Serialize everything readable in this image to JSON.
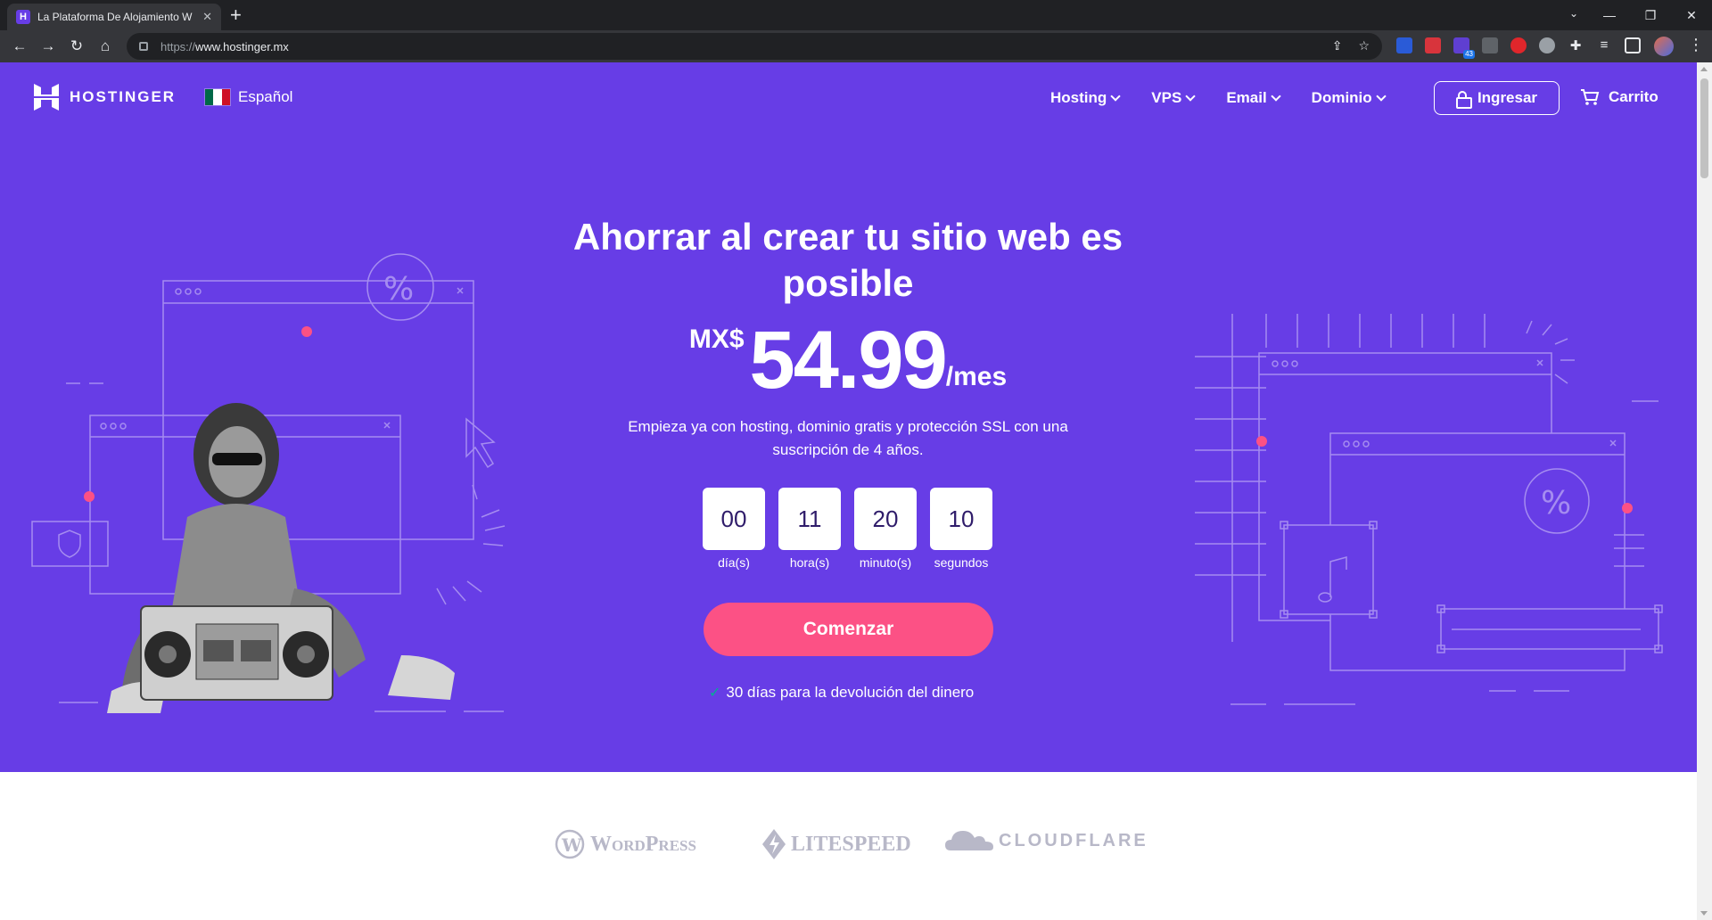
{
  "browser": {
    "tab_title": "La Plataforma De Alojamiento W",
    "url_scheme": "https://",
    "url_host": "www.hostinger.mx",
    "ext_badge_count": "43"
  },
  "header": {
    "logo_text": "HOSTINGER",
    "language": "Español",
    "nav": [
      "Hosting",
      "VPS",
      "Email",
      "Dominio"
    ],
    "login_label": "Ingresar",
    "cart_label": "Carrito"
  },
  "hero": {
    "title": "Ahorrar al crear tu sitio web es posible",
    "currency": "MX$",
    "price": "54.99",
    "period": "/mes",
    "subtitle": "Empieza ya con hosting, dominio gratis y protección SSL con una suscripción de 4 años.",
    "countdown": [
      {
        "value": "00",
        "label": "día(s)"
      },
      {
        "value": "11",
        "label": "hora(s)"
      },
      {
        "value": "20",
        "label": "minuto(s)"
      },
      {
        "value": "10",
        "label": "segundos"
      }
    ],
    "cta_label": "Comenzar",
    "guarantee": "30 días para la devolución del dinero"
  },
  "partners": [
    "WordPress",
    "LITESPEED",
    "CLOUDFLARE"
  ],
  "colors": {
    "brand_purple": "#673de6",
    "cta_pink": "#fc5185",
    "check_green": "#00b090"
  }
}
